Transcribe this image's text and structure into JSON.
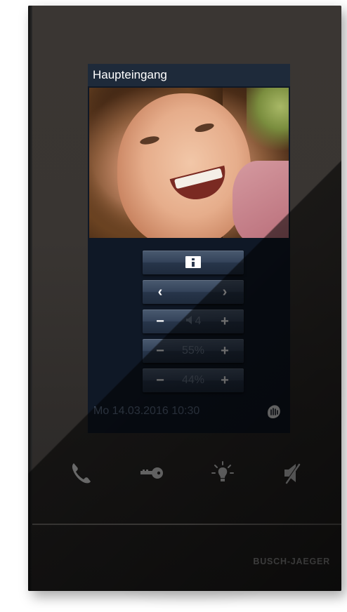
{
  "screen": {
    "title": "Haupteingang",
    "status_datetime": "Mo 14.03.2016   10:30"
  },
  "controls": {
    "info_icon": "info-icon",
    "navigation": {
      "prev": "‹",
      "next": "›"
    },
    "volume": {
      "minus": "−",
      "plus": "+",
      "value": "4",
      "icon": "speaker-icon"
    },
    "brightness": {
      "minus": "−",
      "plus": "+",
      "value": "55%"
    },
    "contrast": {
      "minus": "−",
      "plus": "+",
      "value": "44%"
    }
  },
  "hardware_keys": [
    "phone-icon",
    "key-icon",
    "light-icon",
    "mute-icon"
  ],
  "brand": "BUSCH-JAEGER",
  "colors": {
    "screen_bg": "#0f1826",
    "button_bg": "#34435a",
    "text": "#ffffff",
    "muted_text": "#5e6f88",
    "device_body": "#393532"
  }
}
